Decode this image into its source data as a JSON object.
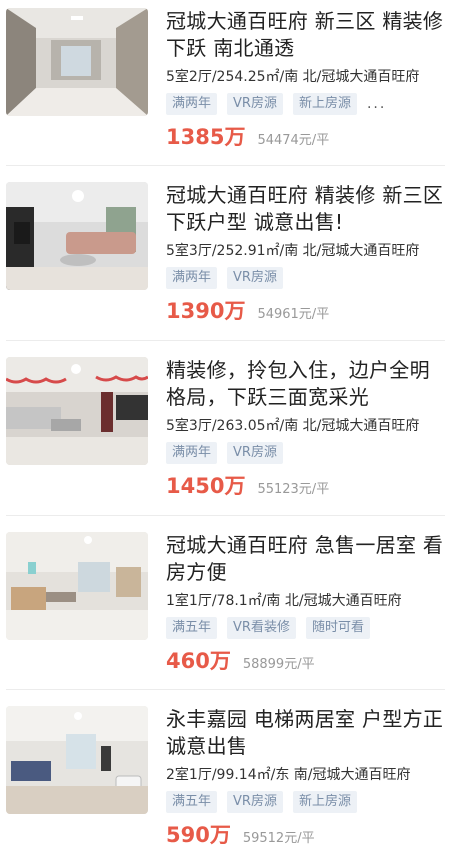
{
  "listings": [
    {
      "title": "冠城大通百旺府 新三区 精装修下跃 南北通透",
      "meta": "5室2厅/254.25㎡/南 北/冠城大通百旺府",
      "tags": [
        "满两年",
        "VR房源",
        "新上房源"
      ],
      "more": "...",
      "price": "1385万",
      "unit_price": "54474元/平"
    },
    {
      "title": "冠城大通百旺府 精装修 新三区下跃户型 诚意出售!",
      "meta": "5室3厅/252.91㎡/南 北/冠城大通百旺府",
      "tags": [
        "满两年",
        "VR房源"
      ],
      "price": "1390万",
      "unit_price": "54961元/平"
    },
    {
      "title": "精装修，拎包入住，边户全明格局，下跃三面宽采光",
      "meta": "5室3厅/263.05㎡/南 北/冠城大通百旺府",
      "tags": [
        "满两年",
        "VR房源"
      ],
      "price": "1450万",
      "unit_price": "55123元/平"
    },
    {
      "title": "冠城大通百旺府 急售一居室 看房方便",
      "meta": "1室1厅/78.1㎡/南 北/冠城大通百旺府",
      "tags": [
        "满五年",
        "VR看装修",
        "随时可看"
      ],
      "price": "460万",
      "unit_price": "58899元/平"
    },
    {
      "title": "永丰嘉园 电梯两居室 户型方正 诚意出售",
      "meta": "2室1厅/99.14㎡/东 南/冠城大通百旺府",
      "tags": [
        "满五年",
        "VR房源",
        "新上房源"
      ],
      "price": "590万",
      "unit_price": "59512元/平"
    }
  ]
}
